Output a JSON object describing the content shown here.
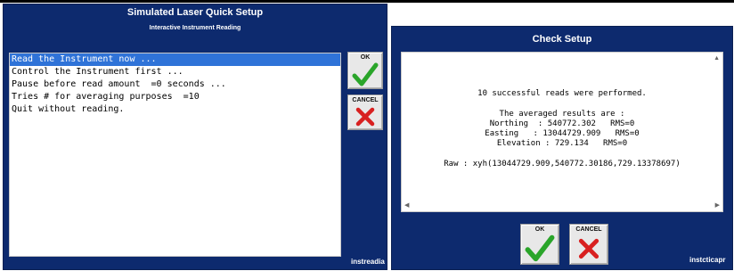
{
  "left_window": {
    "title": "Simulated Laser Quick Setup",
    "subtitle": "Interactive Instrument Reading",
    "options": [
      "Read the Instrument now ...",
      "Control the Instrument first ...",
      "Pause before read amount  =0 seconds ...",
      "Tries # for averaging purposes  =10",
      "Quit without reading."
    ],
    "ok_label": "OK",
    "cancel_label": "CANCEL",
    "footer": "instreadia"
  },
  "right_window": {
    "title": "Check Setup",
    "message": {
      "line1": "10 successful reads were performed.",
      "line2": "The averaged results are :",
      "line3": "Northing  : 540772.302   RMS=0",
      "line4": "Easting   : 13044729.909   RMS=0",
      "line5": "Elevation : 729.134   RMS=0",
      "line6": "Raw : xyh(13044729.909,540772.30186,729.13378697)"
    },
    "ok_label": "OK",
    "cancel_label": "CANCEL",
    "footer": "instcticapr"
  },
  "colors": {
    "window_bg": "#0d2a6e",
    "selection": "#2f73d8",
    "ok_check": "#2aa52a",
    "cancel_x": "#d82020"
  },
  "icons": {
    "ok": "check-icon",
    "cancel": "x-icon"
  }
}
